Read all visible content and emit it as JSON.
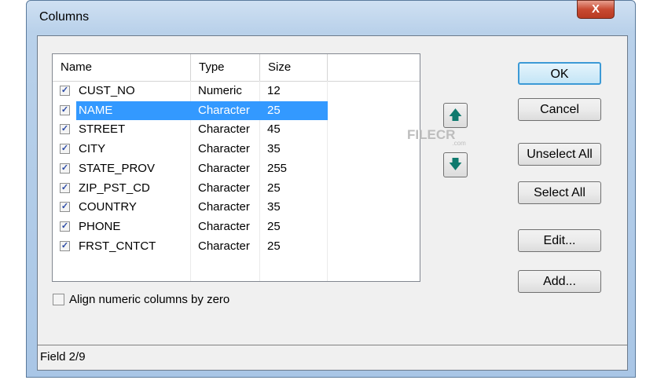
{
  "window": {
    "title": "Columns",
    "close": "X"
  },
  "table": {
    "headers": [
      "Name",
      "Type",
      "Size"
    ],
    "rows": [
      {
        "name": "CUST_NO",
        "type": "Numeric",
        "size": "12",
        "checked": true,
        "selected": false
      },
      {
        "name": "NAME",
        "type": "Character",
        "size": "25",
        "checked": true,
        "selected": true
      },
      {
        "name": "STREET",
        "type": "Character",
        "size": "45",
        "checked": true,
        "selected": false
      },
      {
        "name": "CITY",
        "type": "Character",
        "size": "35",
        "checked": true,
        "selected": false
      },
      {
        "name": "STATE_PROV",
        "type": "Character",
        "size": "255",
        "checked": true,
        "selected": false
      },
      {
        "name": "ZIP_PST_CD",
        "type": "Character",
        "size": "25",
        "checked": true,
        "selected": false
      },
      {
        "name": "COUNTRY",
        "type": "Character",
        "size": "35",
        "checked": true,
        "selected": false
      },
      {
        "name": "PHONE",
        "type": "Character",
        "size": "25",
        "checked": true,
        "selected": false
      },
      {
        "name": "FRST_CNTCT",
        "type": "Character",
        "size": "25",
        "checked": true,
        "selected": false
      }
    ]
  },
  "buttons": {
    "ok": "OK",
    "cancel": "Cancel",
    "unselect_all": "Unselect All",
    "select_all": "Select All",
    "edit": "Edit...",
    "add": "Add..."
  },
  "arrows": {
    "up": "🡅",
    "down": "🡇"
  },
  "options": {
    "align_label": "Align numeric columns by zero",
    "align_checked": false
  },
  "status": "Field 2/9",
  "watermark": "FILECR .com"
}
